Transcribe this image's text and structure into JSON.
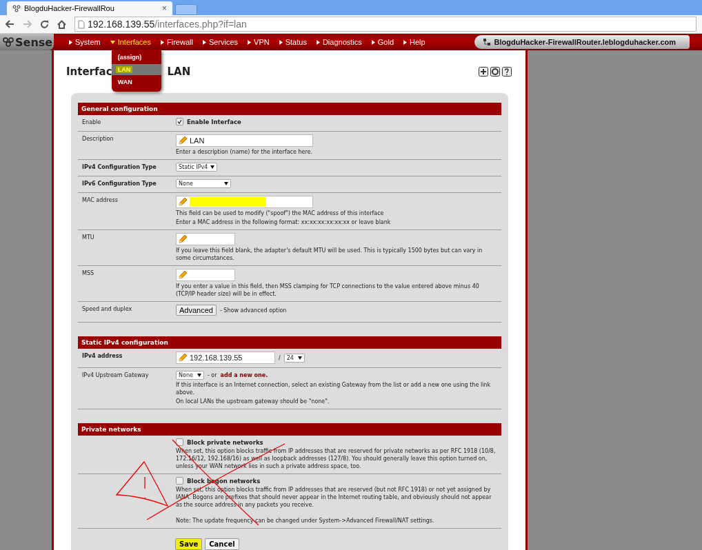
{
  "browser": {
    "tab_title": "BlogduHacker-FirewallRou",
    "tab_close": "×",
    "url_host": "192.168.139.55",
    "url_path": "/interfaces.php?if=lan"
  },
  "navbar": {
    "logo": "Sense",
    "items": [
      {
        "label": "System",
        "expanded": false
      },
      {
        "label": "Interfaces",
        "expanded": true,
        "submenu": [
          {
            "label": "(assign)",
            "selected": false
          },
          {
            "label": "LAN",
            "selected": true
          },
          {
            "label": "WAN",
            "selected": false
          }
        ]
      },
      {
        "label": "Firewall",
        "expanded": false
      },
      {
        "label": "Services",
        "expanded": false
      },
      {
        "label": "VPN",
        "expanded": false
      },
      {
        "label": "Status",
        "expanded": false
      },
      {
        "label": "Diagnostics",
        "expanded": false
      },
      {
        "label": "Gold",
        "expanded": false
      },
      {
        "label": "Help",
        "expanded": false
      }
    ],
    "hostname": "BlogduHacker-FirewallRouter.leblogduhacker.com"
  },
  "page_title": [
    "Interfac",
    "LAN"
  ],
  "sections": [
    {
      "title": "General configuration",
      "rows": [
        {
          "kind": "checkbox",
          "label": "Enable",
          "label_bold": false,
          "checked": true,
          "text": "Enable Interface"
        },
        {
          "kind": "input",
          "label": "Description",
          "label_bold": false,
          "value": "LAN",
          "redacted": false,
          "wide": true,
          "help": [
            "Enter a description (name) for the interface here."
          ]
        },
        {
          "kind": "select",
          "label": "IPv4 Configuration Type",
          "label_bold": true,
          "value": "Static IPv4",
          "wide": false
        },
        {
          "kind": "select",
          "label": "IPv6 Configuration Type",
          "label_bold": true,
          "value": "None",
          "wide": true
        },
        {
          "kind": "input",
          "label": "MAC address",
          "label_bold": false,
          "value": "",
          "redacted": true,
          "wide": true,
          "help": [
            "This field can be used to modify (\"spoof\") the MAC address of this interface",
            "Enter a MAC address in the following format: xx:xx:xx:xx:xx:xx or leave blank"
          ]
        },
        {
          "kind": "input",
          "label": "MTU",
          "label_bold": false,
          "value": "",
          "redacted": false,
          "wide": false,
          "help": [
            "If you leave this field blank, the adapter's default MTU will be used. This is typically 1500 bytes but can vary in some circumstances."
          ]
        },
        {
          "kind": "input",
          "label": "MSS",
          "label_bold": false,
          "value": "",
          "redacted": false,
          "wide": false,
          "help": [
            "If you enter a value in this field, then MSS clamping for TCP connections to the value entered above minus 40 (TCP/IP header size) will be in effect."
          ]
        },
        {
          "kind": "button",
          "label": "Speed and duplex",
          "label_bold": false,
          "button": "Advanced",
          "note": "- Show advanced option"
        }
      ]
    },
    {
      "title": "Static IPv4 configuration",
      "rows": [
        {
          "kind": "address",
          "label": "IPv4 address",
          "label_bold": true,
          "value": "192.168.139.55",
          "separator": "/",
          "mask": "24"
        },
        {
          "kind": "gateway",
          "label": "IPv4 Upstream Gateway",
          "label_bold": false,
          "value": "None",
          "note": "- or",
          "link": "add a new one.",
          "help": [
            "If this interface is an Internet connection, select an existing Gateway from the list or add a new one using the link above.",
            "On local LANs the upstream gateway should be \"none\"."
          ]
        }
      ]
    },
    {
      "title": "Private networks",
      "crossed_out": true,
      "warning_sign": true,
      "rows": [
        {
          "kind": "checkbox",
          "checked": false,
          "text": "Block private networks",
          "help": [
            "When set, this option blocks traffic from IP addresses that are reserved for private networks as per RFC 1918 (10/8, 172.16/12, 192.168/16) as well as loopback addresses (127/8).   You should generally leave this option turned on, unless your WAN network lies in such a private address space, too."
          ]
        },
        {
          "kind": "checkbox",
          "checked": false,
          "text": "Block bogon networks",
          "help": [
            "When set, this option blocks traffic from IP addresses that are reserved (but not RFC 1918) or not yet assigned by IANA.   Bogons are prefixes that should never appear in the Internet routing table, and obviously should not appear as the source address in any packets you receive.",
            "Note: The update frequency can be changed under System->Advanced Firewall/NAT settings."
          ]
        }
      ]
    }
  ],
  "actions": [
    {
      "label": "Save",
      "primary": true
    },
    {
      "label": "Cancel",
      "primary": false
    }
  ]
}
